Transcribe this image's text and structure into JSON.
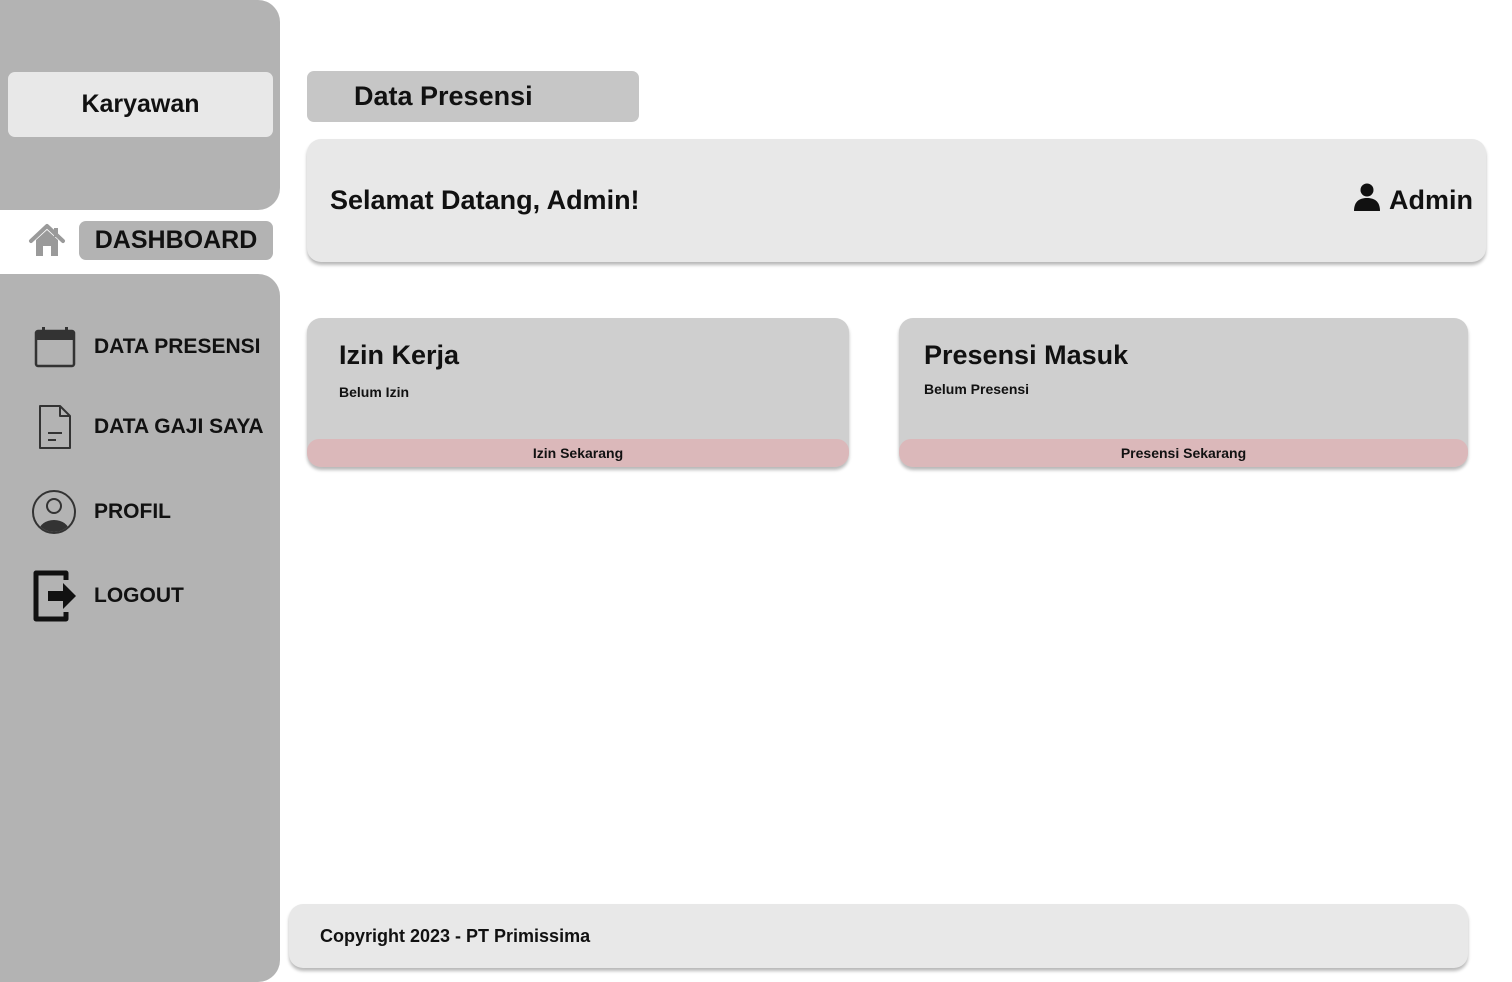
{
  "sidebar": {
    "role_label": "Karyawan",
    "active_item": {
      "label": "DASHBOARD",
      "icon": "home-icon"
    },
    "items": [
      {
        "label": "DATA PRESENSI",
        "icon": "calendar-icon"
      },
      {
        "label": "DATA GAJI SAYA",
        "icon": "document-icon"
      },
      {
        "label": "PROFIL",
        "icon": "user-circle-icon"
      },
      {
        "label": "LOGOUT",
        "icon": "logout-icon"
      }
    ]
  },
  "header": {
    "page_title": "Data Presensi",
    "welcome": "Selamat Datang, Admin!",
    "user_name": "Admin",
    "user_icon": "user-icon"
  },
  "cards": [
    {
      "title": "Izin Kerja",
      "status": "Belum Izin",
      "button": "Izin Sekarang"
    },
    {
      "title": "Presensi Masuk",
      "status": "Belum Presensi",
      "button": "Presensi Sekarang"
    }
  ],
  "footer": {
    "text": "Copyright 2023 - PT Primissima"
  },
  "colors": {
    "sidebar": "#b3b3b3",
    "panel": "#e8e8e8",
    "card": "#cfcfcf",
    "button": "#dbb8ba",
    "title_pill": "#c6c6c6"
  }
}
